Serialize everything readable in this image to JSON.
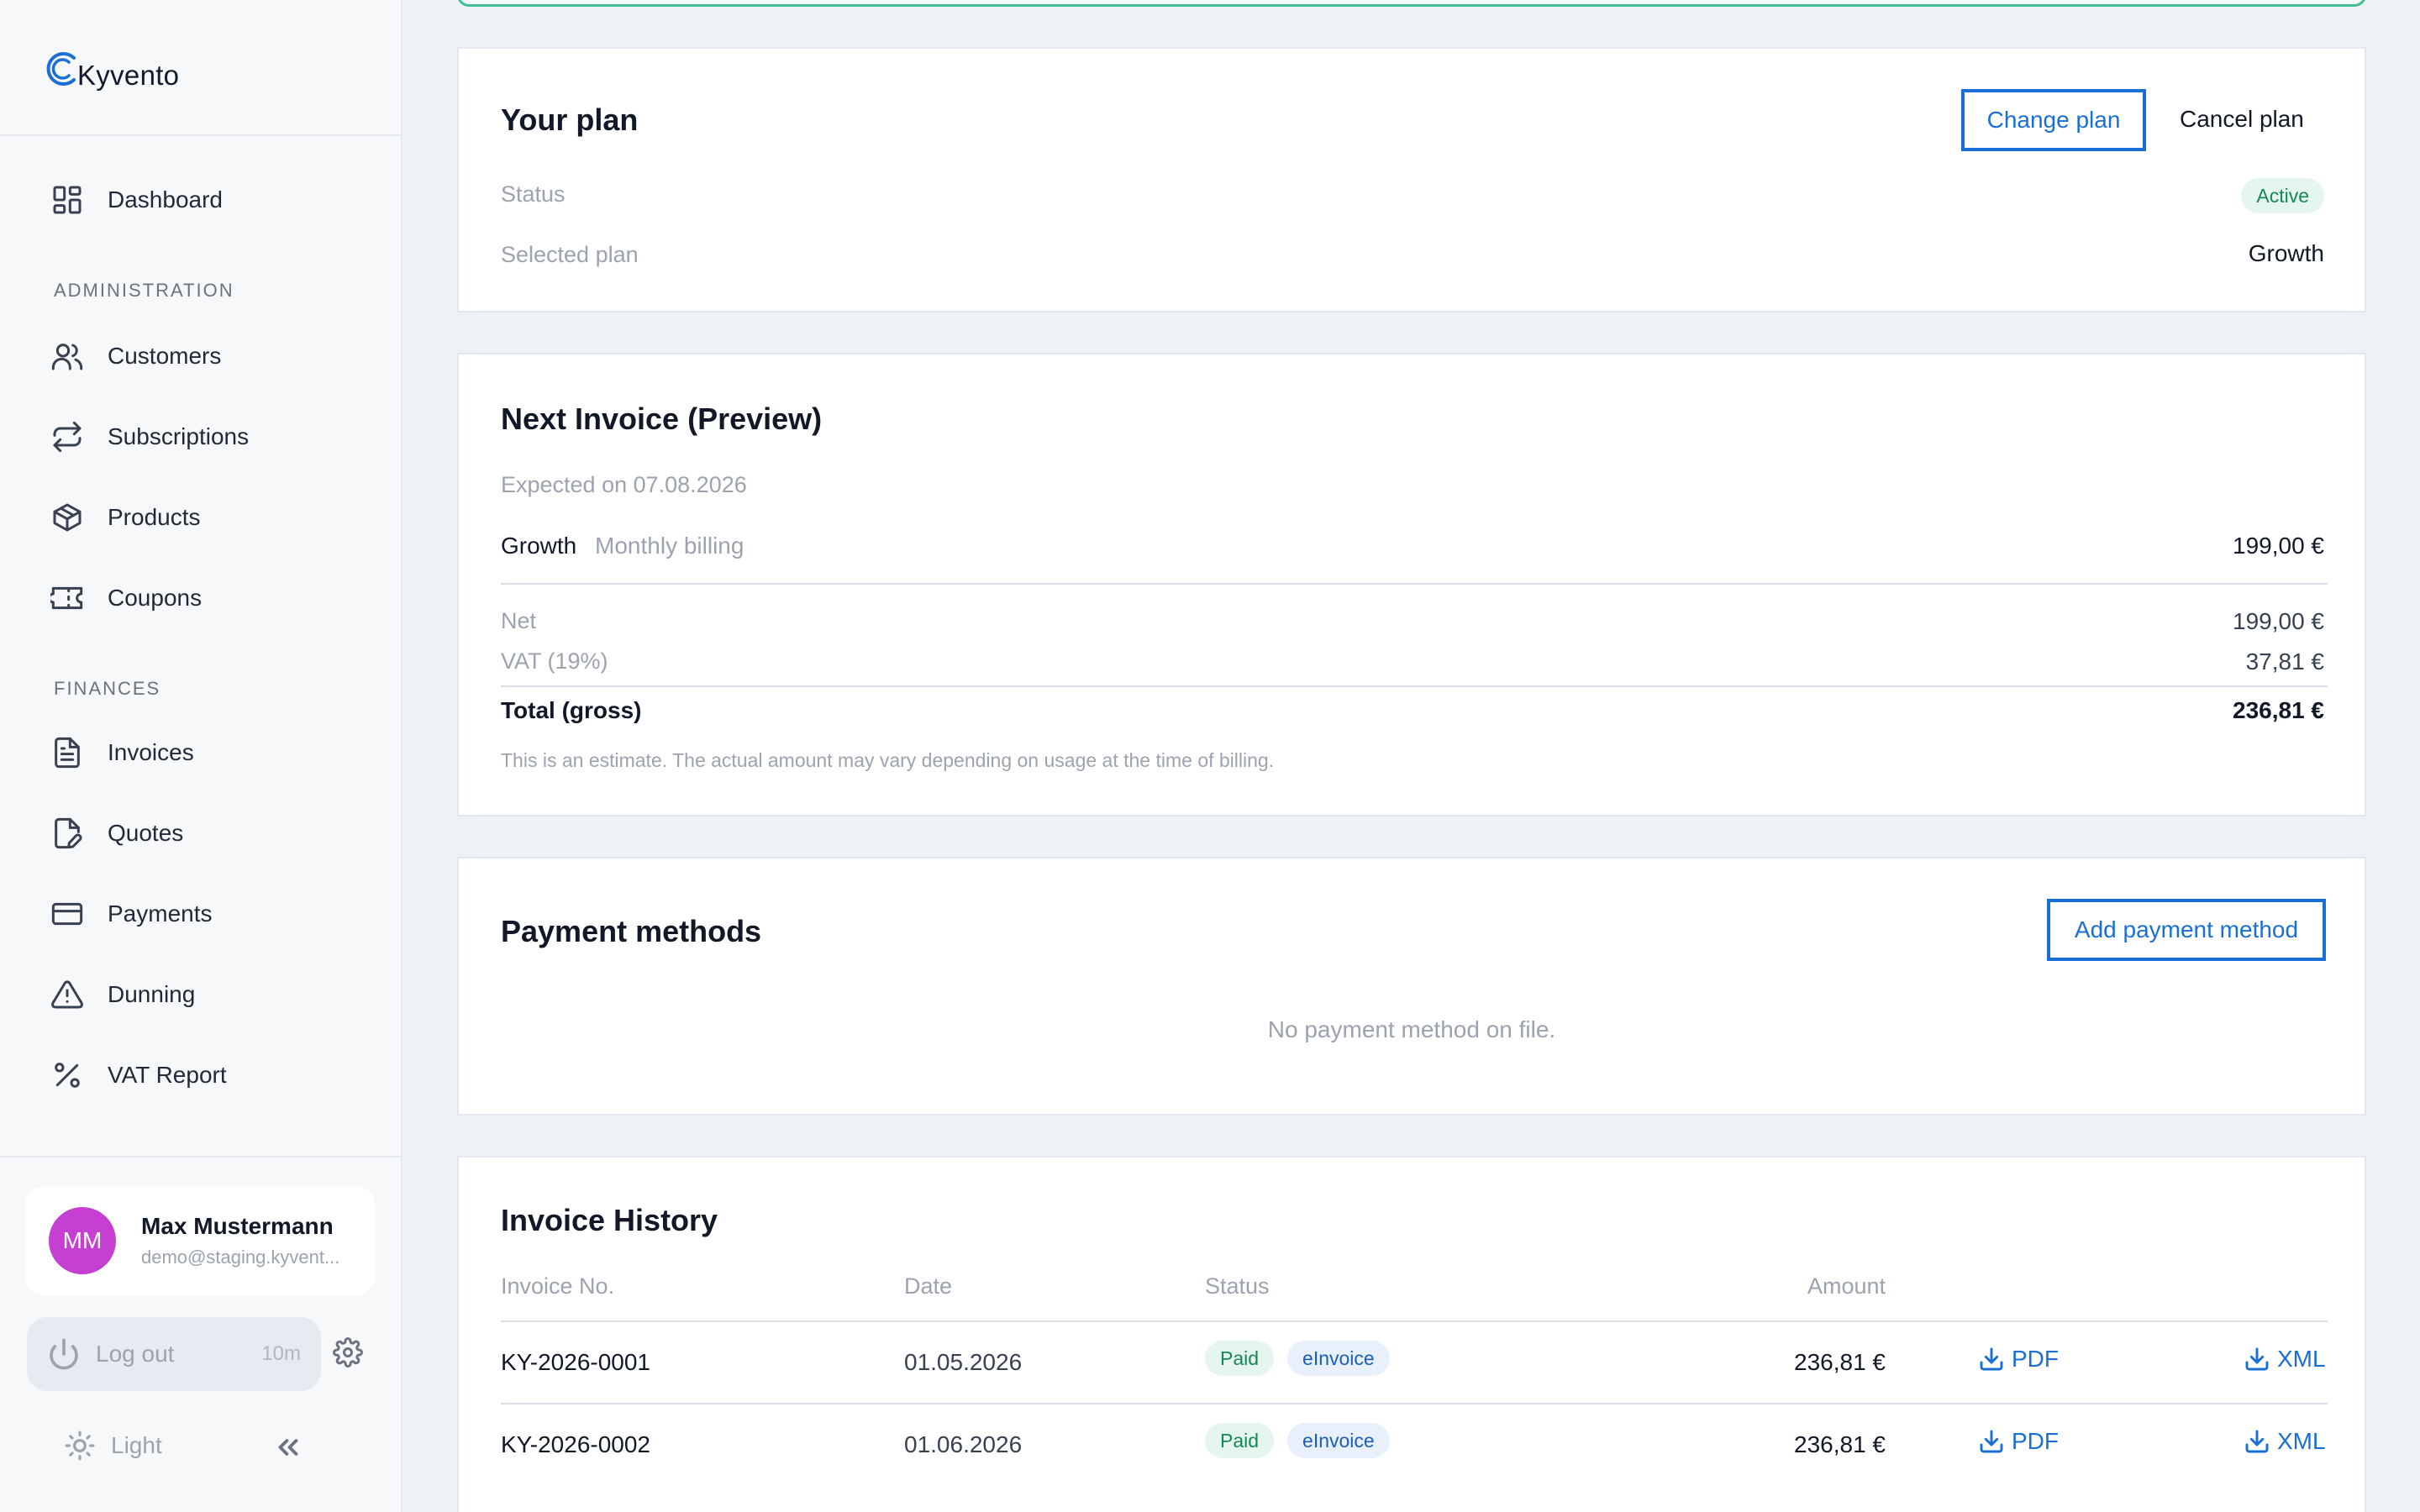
{
  "app": {
    "name": "Kyvento"
  },
  "colors": {
    "accent": "#1a6fd6",
    "success": "#16875a",
    "avatar": "#c43fd2"
  },
  "sidebar": {
    "dashboard": {
      "label": "Dashboard",
      "icon": "dashboard-icon"
    },
    "sections": {
      "administration": "ADMINISTRATION",
      "finances": "FINANCES"
    },
    "administration_items": [
      {
        "label": "Customers",
        "icon": "users-icon"
      },
      {
        "label": "Subscriptions",
        "icon": "repeat-icon"
      },
      {
        "label": "Products",
        "icon": "box-icon"
      },
      {
        "label": "Coupons",
        "icon": "ticket-icon"
      }
    ],
    "finance_items": [
      {
        "label": "Invoices",
        "icon": "file-icon"
      },
      {
        "label": "Quotes",
        "icon": "file-edit-icon"
      },
      {
        "label": "Payments",
        "icon": "credit-card-icon"
      },
      {
        "label": "Dunning",
        "icon": "alert-triangle-icon"
      },
      {
        "label": "VAT Report",
        "icon": "percent-icon"
      }
    ],
    "user": {
      "initials": "MM",
      "name": "Max Mustermann",
      "email": "demo@staging.kyvent..."
    },
    "logout": {
      "label": "Log out",
      "timer": "10m"
    },
    "theme": {
      "label": "Light"
    }
  },
  "plan": {
    "title": "Your plan",
    "change_label": "Change plan",
    "cancel_label": "Cancel plan",
    "status_label": "Status",
    "status_value": "Active",
    "selected_label": "Selected plan",
    "selected_value": "Growth"
  },
  "next_invoice": {
    "title": "Next Invoice (Preview)",
    "expected": "Expected on 07.08.2026",
    "line_name": "Growth",
    "line_desc": "Monthly billing",
    "line_amount": "199,00 €",
    "net_label": "Net",
    "net_value": "199,00 €",
    "vat_label": "VAT (19%)",
    "vat_value": "37,81 €",
    "total_label": "Total (gross)",
    "total_value": "236,81 €",
    "note": "This is an estimate. The actual amount may vary depending on usage at the time of billing."
  },
  "payment_methods": {
    "title": "Payment methods",
    "add_label": "Add payment method",
    "empty": "No payment method on file."
  },
  "invoice_history": {
    "title": "Invoice History",
    "columns": {
      "number": "Invoice No.",
      "date": "Date",
      "status": "Status",
      "amount": "Amount"
    },
    "rows": [
      {
        "number": "KY-2026-0001",
        "date": "01.05.2026",
        "status": "Paid",
        "tag": "eInvoice",
        "amount": "236,81 €",
        "pdf": "PDF",
        "xml": "XML"
      },
      {
        "number": "KY-2026-0002",
        "date": "01.06.2026",
        "status": "Paid",
        "tag": "eInvoice",
        "amount": "236,81 €",
        "pdf": "PDF",
        "xml": "XML"
      }
    ]
  }
}
